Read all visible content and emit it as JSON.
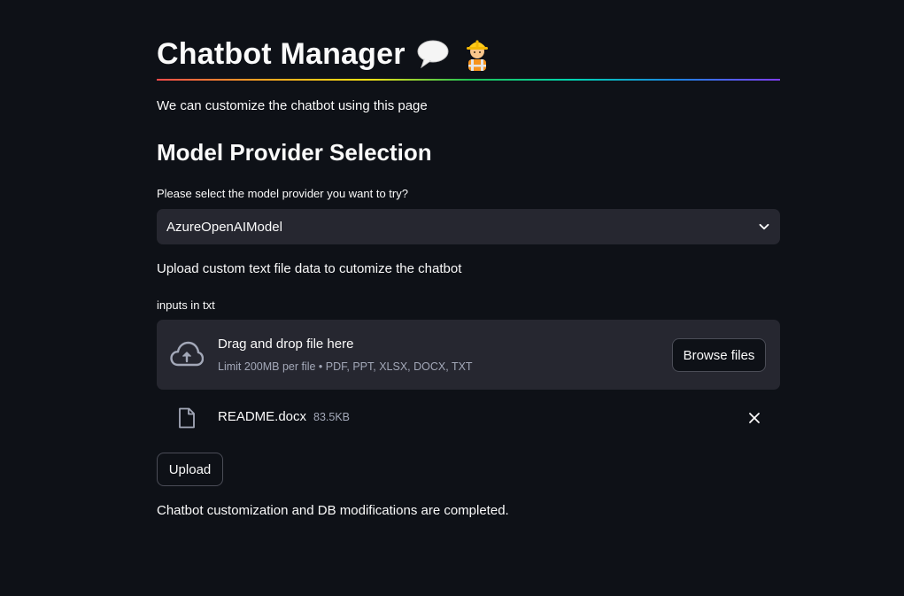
{
  "header": {
    "title": "Chatbot Manager",
    "icons": [
      "speech-balloon-icon",
      "construction-worker-icon"
    ]
  },
  "intro": {
    "text": "We can customize the chatbot using this page"
  },
  "model_section": {
    "heading": "Model Provider Selection",
    "select_label": "Please select the model provider you want to try?",
    "selected_value": "AzureOpenAIModel"
  },
  "upload_section": {
    "description": "Upload custom text file data to cutomize the chatbot",
    "uploader_label": "inputs in txt",
    "dropzone_title": "Drag and drop file here",
    "dropzone_limit": "Limit 200MB per file • PDF, PPT, XLSX, DOCX, TXT",
    "browse_label": "Browse files",
    "files": [
      {
        "name": "README.docx",
        "size": "83.5KB"
      }
    ],
    "upload_label": "Upload"
  },
  "status": {
    "message": "Chatbot customization and DB modifications are completed."
  },
  "colors": {
    "background": "#0e1117",
    "panel": "#262730",
    "text": "#fafafa",
    "muted": "#a3a8b8",
    "rainbow": [
      "#ff4b4b",
      "#ffa421",
      "#ffe312",
      "#21c354",
      "#00d4b1",
      "#1c83e1",
      "#803df5"
    ]
  }
}
